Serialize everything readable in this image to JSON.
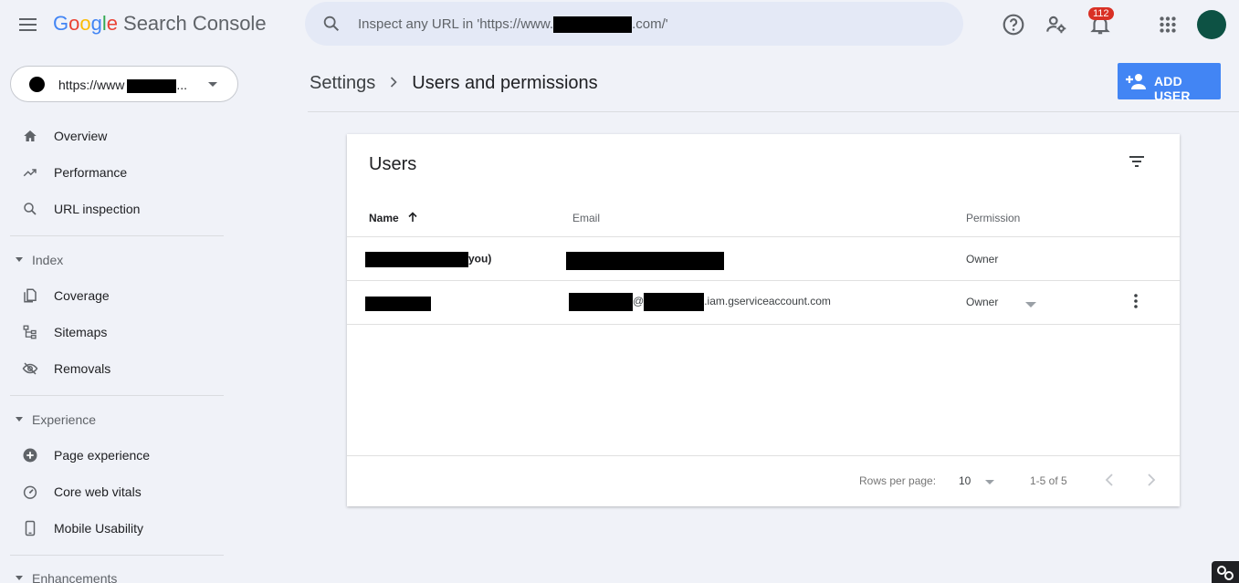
{
  "app": {
    "logo_google": [
      "G",
      "o",
      "o",
      "g",
      "l",
      "e"
    ],
    "logo_product": "Search Console"
  },
  "search": {
    "text_before": "Inspect any URL in 'https://www.",
    "text_after": ".com/'"
  },
  "topbar": {
    "notifications_count": "112"
  },
  "property": {
    "label": "https://www",
    "ellipsis": "..."
  },
  "sidebar": {
    "items_top": [
      {
        "label": "Overview",
        "icon": "home-icon"
      },
      {
        "label": "Performance",
        "icon": "trending-up-icon"
      },
      {
        "label": "URL inspection",
        "icon": "search-icon"
      }
    ],
    "sections": [
      {
        "label": "Index",
        "items": [
          {
            "label": "Coverage",
            "icon": "coverage-icon"
          },
          {
            "label": "Sitemaps",
            "icon": "sitemap-icon"
          },
          {
            "label": "Removals",
            "icon": "eye-off-icon"
          }
        ]
      },
      {
        "label": "Experience",
        "items": [
          {
            "label": "Page experience",
            "icon": "plus-circle-icon"
          },
          {
            "label": "Core web vitals",
            "icon": "speed-gauge-icon"
          },
          {
            "label": "Mobile Usability",
            "icon": "phone-icon"
          }
        ]
      },
      {
        "label": "Enhancements",
        "items": []
      }
    ]
  },
  "header": {
    "breadcrumb_parent": "Settings",
    "breadcrumb_current": "Users and permissions",
    "add_user_label": "ADD USER"
  },
  "users_card": {
    "title": "Users",
    "columns": {
      "name": "Name",
      "email": "Email",
      "permission": "Permission"
    },
    "rows": [
      {
        "name_suffix": "you)",
        "permission": "Owner"
      },
      {
        "email_at": "@",
        "email_domain": ".iam.gserviceaccount.com",
        "permission": "Owner"
      }
    ],
    "footer": {
      "rows_per_page_label": "Rows per page:",
      "rows_per_page_value": "10",
      "range": "1-5 of 5"
    }
  },
  "colors": {
    "accent": "#4285f4",
    "background": "#f0f2f8",
    "badge": "#d93025",
    "avatar": "#0d5244"
  }
}
